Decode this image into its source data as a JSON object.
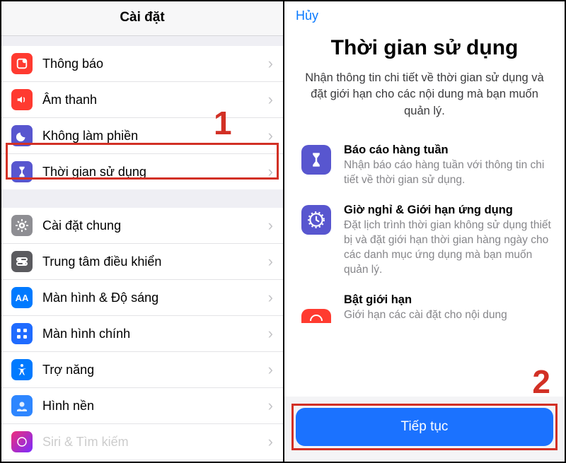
{
  "left": {
    "title": "Cài đặt",
    "group1": [
      {
        "label": "Thông báo",
        "icon": "notifications"
      },
      {
        "label": "Âm thanh",
        "icon": "sound"
      },
      {
        "label": "Không làm phiền",
        "icon": "dnd"
      },
      {
        "label": "Thời gian sử dụng",
        "icon": "screentime"
      }
    ],
    "group2": [
      {
        "label": "Cài đặt chung",
        "icon": "general"
      },
      {
        "label": "Trung tâm điều khiển",
        "icon": "control"
      },
      {
        "label": "Màn hình & Độ sáng",
        "icon": "display"
      },
      {
        "label": "Màn hình chính",
        "icon": "home"
      },
      {
        "label": "Trợ năng",
        "icon": "accessibility"
      },
      {
        "label": "Hình nền",
        "icon": "wallpaper"
      }
    ]
  },
  "right": {
    "cancel": "Hủy",
    "title": "Thời gian sử dụng",
    "subtitle": "Nhận thông tin chi tiết về thời gian sử dụng và đặt giới hạn cho các nội dung mà bạn muốn quản lý.",
    "features": [
      {
        "title": "Báo cáo hàng tuần",
        "desc": "Nhận báo cáo hàng tuần với thông tin chi tiết về thời gian sử dụng.",
        "icon": "screentime"
      },
      {
        "title": "Giờ nghỉ & Giới hạn ứng dụng",
        "desc": "Đặt lịch trình thời gian không sử dụng thiết bị và đặt giới hạn thời gian hàng ngày cho các danh mục ứng dụng mà bạn muốn quản lý.",
        "icon": "downtime"
      },
      {
        "title": "Bật giới hạn",
        "desc": "Giới hạn các cài đặt cho nội dung",
        "icon": "limit"
      }
    ],
    "cta": "Tiếp tục"
  },
  "annotations": {
    "step1": "1",
    "step2": "2"
  }
}
